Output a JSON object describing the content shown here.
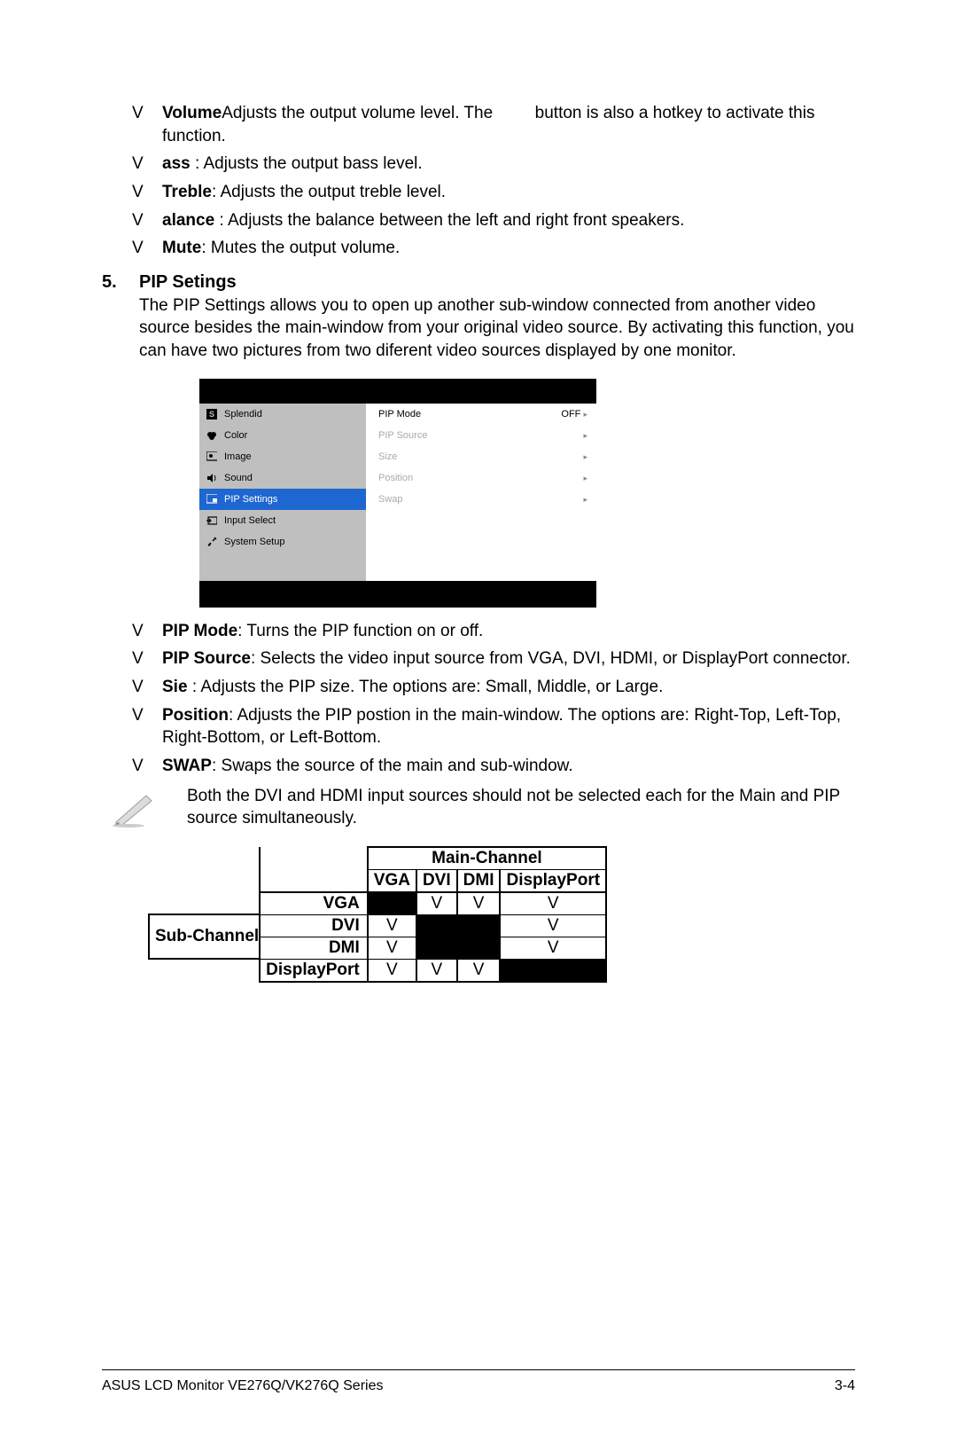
{
  "bullet": "V",
  "top_bullets": [
    {
      "label": "Volume",
      "sep": ": ",
      "text_a": "Adjusts the output volume level. The ",
      "text_b": " button is also a hotkey to activate this function."
    },
    {
      "label": "ass ",
      "sep": ": ",
      "text": "Adjusts the output bass level."
    },
    {
      "label": "Treble",
      "sep": ": ",
      "text": "Adjusts the output treble level."
    },
    {
      "label": "alance ",
      "sep": ": ",
      "text": "Adjusts the balance between the left and right front speakers."
    },
    {
      "label": "Mute",
      "sep": ": ",
      "text": "Mutes the output volume."
    }
  ],
  "section": {
    "num": "5.",
    "title": "PIP Setings",
    "para": "The PIP Settings allows you to open up another sub-window connected from another video source besides the main-window from your original video source. By activating this function, you can have two pictures from two diferent video sources displayed by one monitor."
  },
  "osd": {
    "left": [
      {
        "label": "Splendid",
        "icon": "S"
      },
      {
        "label": "Color",
        "icon": "color"
      },
      {
        "label": "Image",
        "icon": "image"
      },
      {
        "label": "Sound",
        "icon": "sound"
      },
      {
        "label": "PIP Settings",
        "icon": "pip",
        "selected": true
      },
      {
        "label": "Input Select",
        "icon": "input"
      },
      {
        "label": "System Setup",
        "icon": "setup"
      }
    ],
    "right": [
      {
        "label": "PIP Mode",
        "value": "OFF",
        "dim": false,
        "arrow": "▸"
      },
      {
        "label": "PIP Source",
        "dim": true,
        "arrow": "▸"
      },
      {
        "label": "Size",
        "dim": true,
        "arrow": "▸"
      },
      {
        "label": "Position",
        "dim": true,
        "arrow": "▸"
      },
      {
        "label": "Swap",
        "dim": true,
        "arrow": "▸"
      }
    ]
  },
  "pip_bullets": [
    {
      "label": "PIP Mode",
      "sep": ": ",
      "text": "Turns the PIP function on or off."
    },
    {
      "label": "PIP Source",
      "sep": ": ",
      "text": "Selects the video input source from VGA, DVI, HDMI, or DisplayPort connector."
    },
    {
      "label": "Sie ",
      "sep": ": ",
      "text": "Adjusts the PIP size. The options are: Small, Middle, or Large."
    },
    {
      "label": "Position",
      "sep": ": ",
      "text": "Adjusts the PIP postion in the main-window. The options are: Right-Top, Left-Top, Right-Bottom, or Left-Bottom."
    },
    {
      "label": "SWAP",
      "sep": ": ",
      "text": "Swaps the source of the main and sub-window."
    }
  ],
  "note": "Both the DVI and HDMI input sources should not be selected each for the Main and PIP source simultaneously.",
  "matrix": {
    "main_header": "Main-Channel",
    "sub_header": "Sub-Channel",
    "cols": [
      "VGA",
      "DVI",
      "DMI",
      "DisplayPort"
    ],
    "rows": [
      {
        "label": "VGA",
        "cells": [
          "blk",
          "V",
          "V",
          "V"
        ]
      },
      {
        "label": "DVI",
        "cells": [
          "V",
          "blk",
          "blk",
          "V"
        ]
      },
      {
        "label": "DMI",
        "cells": [
          "V",
          "blk",
          "blk",
          "V"
        ]
      },
      {
        "label": "DisplayPort",
        "cells": [
          "V",
          "V",
          "V",
          "blk"
        ]
      }
    ]
  },
  "footer": {
    "left": "ASUS LCD Monitor VE276Q/VK276Q Series",
    "right": "3-4"
  }
}
